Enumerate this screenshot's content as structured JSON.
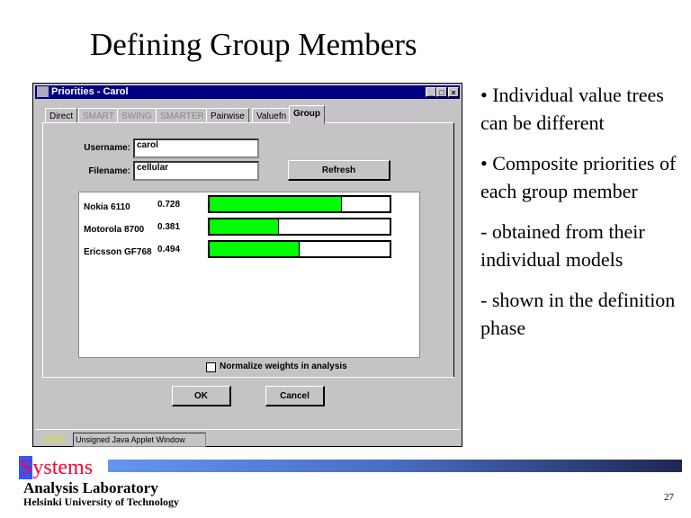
{
  "slide": {
    "title": "Defining Group Members",
    "page_number": "27",
    "bullets": [
      {
        "text": "• Individual value trees can be different"
      },
      {
        "text": "• Composite priorities of each group member"
      },
      {
        "text": " - obtained from their individual models"
      },
      {
        "text": " - shown in the definition phase"
      }
    ]
  },
  "window": {
    "title": "Priorities - Carol",
    "tabs": [
      {
        "label": "Direct"
      },
      {
        "label": "SMART"
      },
      {
        "label": "SWING"
      },
      {
        "label": "SMARTER"
      },
      {
        "label": "Pairwise"
      },
      {
        "label": "Valuefn"
      },
      {
        "label": "Group"
      }
    ],
    "username_label": "Username:",
    "username_value": "carol",
    "filename_label": "Filename:",
    "filename_value": "cellular",
    "refresh_label": "Refresh",
    "items": [
      {
        "name": "Nokia 6110",
        "value": "0.728",
        "fraction": 0.728
      },
      {
        "name": "Motorola 8700",
        "value": "0.381",
        "fraction": 0.381
      },
      {
        "name": "Ericsson GF768",
        "value": "0.494",
        "fraction": 0.494
      }
    ],
    "normalize_label": "Normalize weights in analysis",
    "ok_label": "OK",
    "cancel_label": "Cancel",
    "status_text": "Unsigned Java Applet Window"
  },
  "logo": {
    "line1": "Systems",
    "line2": "Analysis Laboratory",
    "line3": "Helsinki University of Technology"
  },
  "colors": {
    "bar_fill": "#00ff00",
    "titlebar": "#000080",
    "logo_red": "#ff0033",
    "logo_blue": "#3355ff"
  }
}
